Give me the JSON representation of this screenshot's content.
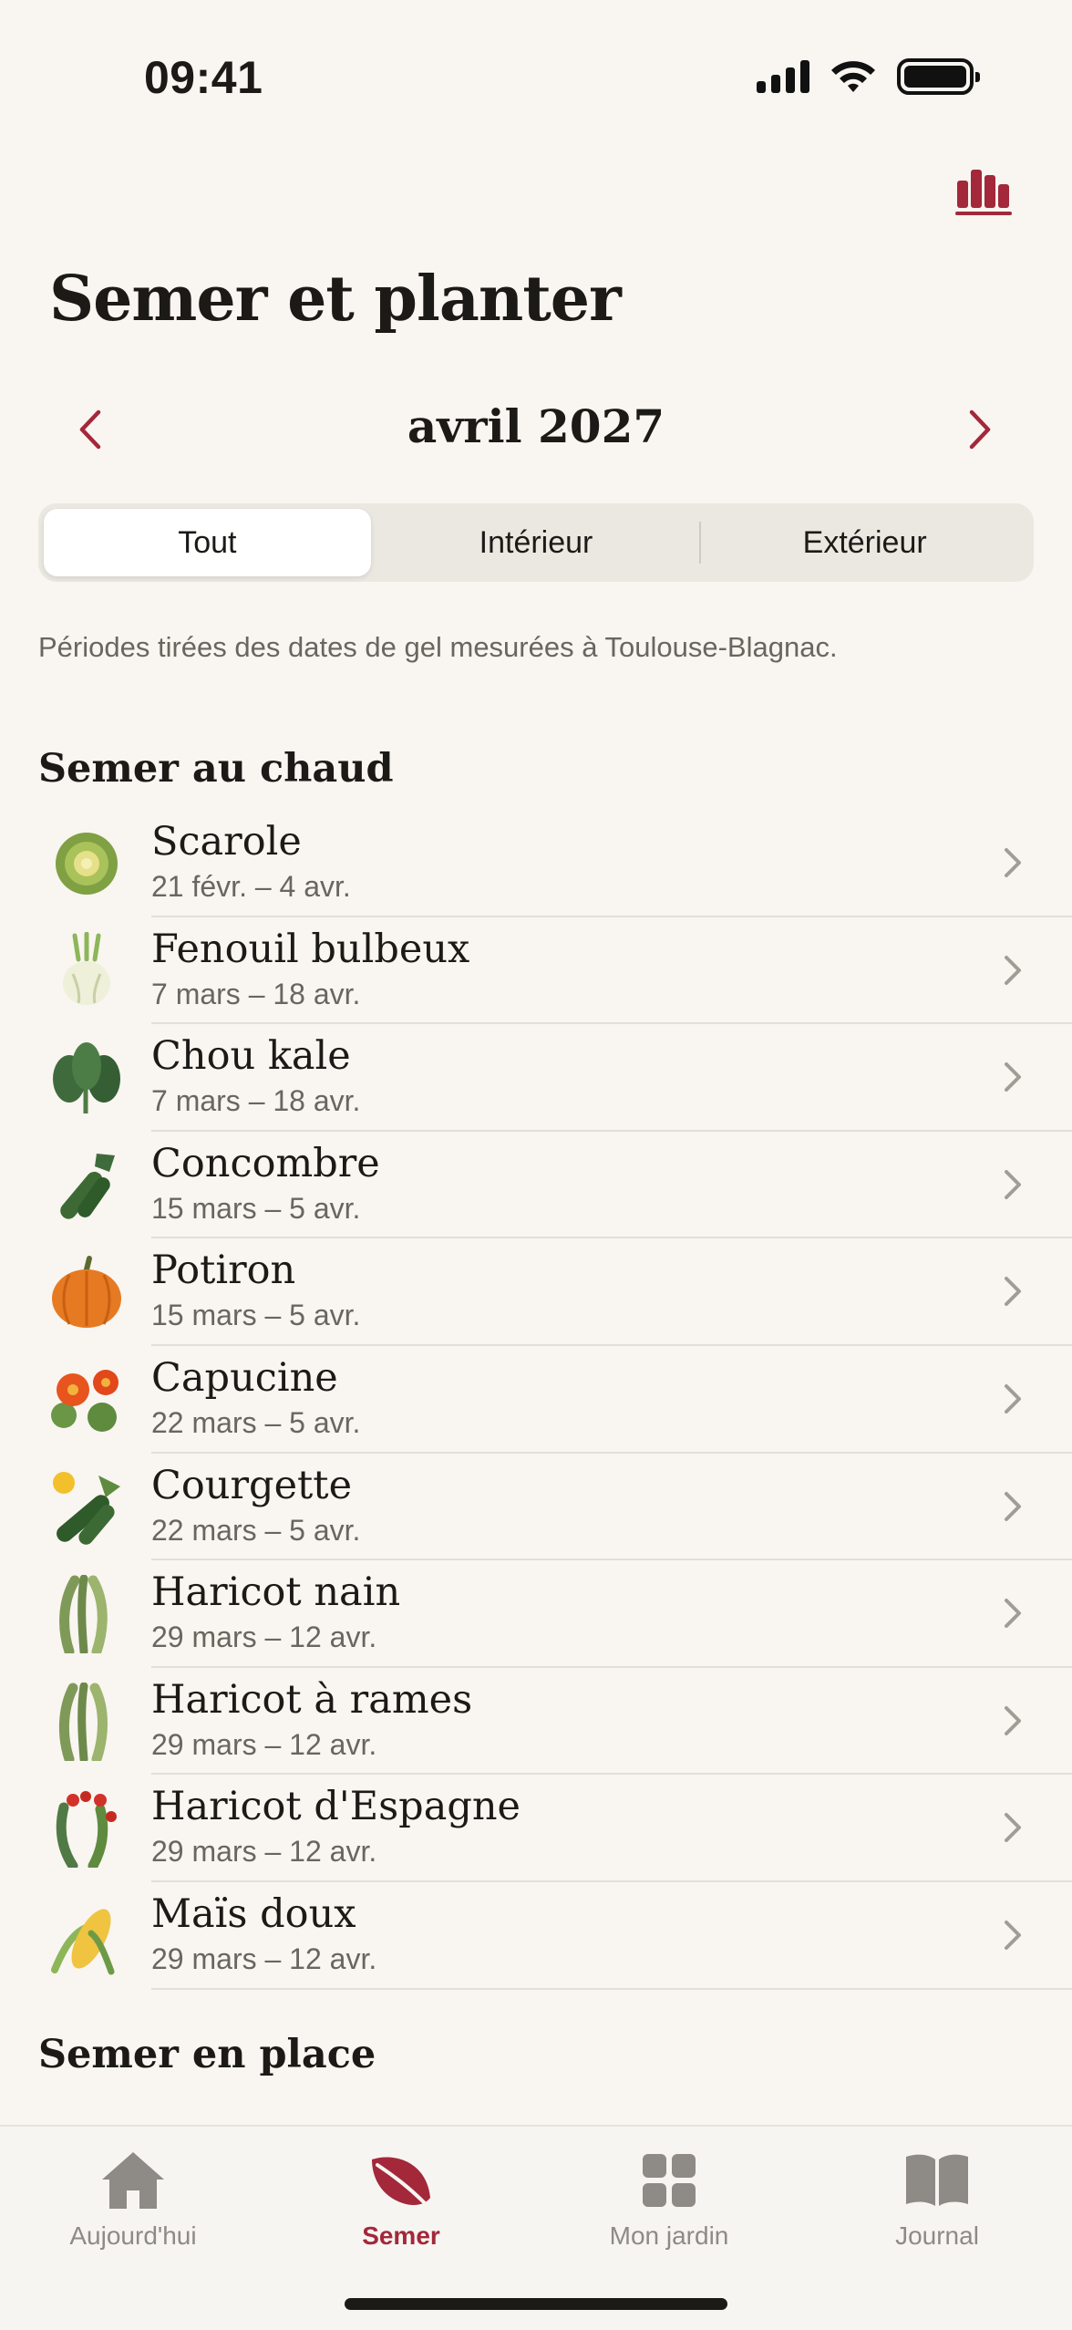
{
  "status": {
    "time": "09:41"
  },
  "colors": {
    "accent": "#a3283a",
    "background": "#f9f5f0",
    "segment_bg": "#ebe7e1",
    "muted": "#6b6560",
    "chevron": "#a19c96"
  },
  "header": {
    "title": "Semer et planter",
    "stats_icon": "bar-chart-icon"
  },
  "month_nav": {
    "label": "avril 2027",
    "prev_icon": "chevron-left-icon",
    "next_icon": "chevron-right-icon"
  },
  "filter": {
    "options": [
      "Tout",
      "Intérieur",
      "Extérieur"
    ],
    "selected": "Tout"
  },
  "note": "Périodes tirées des dates de gel mesurées à Toulouse-Blagnac.",
  "sections": [
    {
      "title": "Semer au chaud",
      "items": [
        {
          "name": "Scarole",
          "dates": "21 févr. – 4 avr.",
          "icon": "escarole-icon"
        },
        {
          "name": "Fenouil bulbeux",
          "dates": "7 mars – 18 avr.",
          "icon": "fennel-icon"
        },
        {
          "name": "Chou kale",
          "dates": "7 mars – 18 avr.",
          "icon": "kale-icon"
        },
        {
          "name": "Concombre",
          "dates": "15 mars – 5 avr.",
          "icon": "cucumber-icon"
        },
        {
          "name": "Potiron",
          "dates": "15 mars – 5 avr.",
          "icon": "pumpkin-icon"
        },
        {
          "name": "Capucine",
          "dates": "22 mars – 5 avr.",
          "icon": "nasturtium-icon"
        },
        {
          "name": "Courgette",
          "dates": "22 mars – 5 avr.",
          "icon": "zucchini-icon"
        },
        {
          "name": "Haricot nain",
          "dates": "29 mars – 12 avr.",
          "icon": "bean-icon"
        },
        {
          "name": "Haricot à rames",
          "dates": "29 mars – 12 avr.",
          "icon": "pole-bean-icon"
        },
        {
          "name": "Haricot d'Espagne",
          "dates": "29 mars – 12 avr.",
          "icon": "runner-bean-icon"
        },
        {
          "name": "Maïs doux",
          "dates": "29 mars – 12 avr.",
          "icon": "corn-icon"
        }
      ]
    },
    {
      "title": "Semer en place",
      "items": []
    }
  ],
  "tabs": [
    {
      "label": "Aujourd'hui",
      "icon": "house-icon",
      "active": false
    },
    {
      "label": "Semer",
      "icon": "leaf-icon",
      "active": true
    },
    {
      "label": "Mon jardin",
      "icon": "grid-icon",
      "active": false
    },
    {
      "label": "Journal",
      "icon": "book-icon",
      "active": false
    }
  ]
}
